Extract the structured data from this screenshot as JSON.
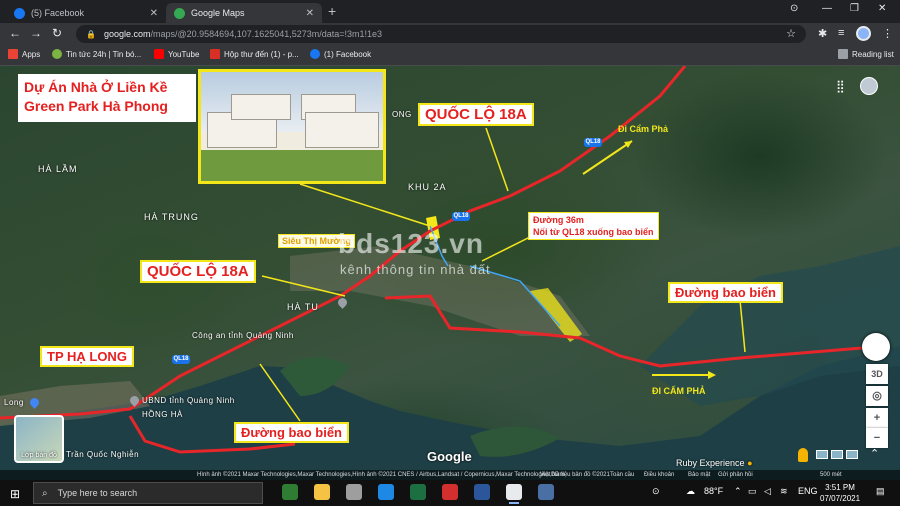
{
  "browser": {
    "tabs": [
      {
        "label": "(5) Facebook",
        "active": false,
        "favicon": "facebook-icon",
        "color": "#1877f2"
      },
      {
        "label": "Google Maps",
        "active": true,
        "favicon": "maps-icon",
        "color": "#34a853"
      }
    ],
    "address": {
      "host": "google.com",
      "path": "/maps/@20.9584694,107.1625041,5273m/data=!3m1!1e3"
    },
    "bookmarks": [
      {
        "label": "Apps",
        "icon": "apps-grid-icon"
      },
      {
        "label": "Tin tức 24h | Tin bó...",
        "icon": "news-icon"
      },
      {
        "label": "YouTube",
        "icon": "youtube-icon"
      },
      {
        "label": "Hộp thư đến (1) - p...",
        "icon": "gmail-icon"
      },
      {
        "label": "(1) Facebook",
        "icon": "facebook-icon"
      }
    ],
    "reading_list": "Reading list"
  },
  "map": {
    "project_title": [
      "Dự Án Nhà Ở Liền Kề",
      "Green Park Hà Phong"
    ],
    "callouts": {
      "ql18a_top": "QUỐC LỘ 18A",
      "ql18a_left": "QUỐC LỘ 18A",
      "tp_ha_long": "TP HẠ LONG",
      "duong_bao_bien_bottom": "Đường bao biển",
      "duong_bao_bien_right": "Đường bao biển",
      "duong_36m": [
        "Đường 36m",
        "Nối từ QL18 xuống bao biển"
      ],
      "sieu_thi": "Siêu Thị Mường"
    },
    "directions": {
      "di_cam_pha_top": "Đi Cẩm Phả",
      "di_cam_pha_bottom": "ĐI CẨM PHẢ"
    },
    "places": {
      "ha_lam": "HÀ LẦM",
      "ha_trung": "HÀ TRUNG",
      "khu_2a": "KHU 2A",
      "ha_tu": "HÀ TU",
      "cong_an": "Công an tỉnh Quảng Ninh",
      "ubnd": "UBND tỉnh Quảng Ninh",
      "hong_ha": "HỒNG HÀ",
      "long": "Long",
      "tran_quoc_nghien": "Trần Quốc Nghiễn",
      "ong": "ONG"
    },
    "shields": [
      "QL18",
      "QL18",
      "QL18"
    ],
    "watermark": "bds123.vn",
    "watermark_sub": "kênh thông tin nhà đất",
    "google_logo": "Google",
    "layer_button": "Lớp bản đồ",
    "ruby": "Ruby Experience",
    "controls": [
      "3D",
      "+",
      "−"
    ],
    "attribution": {
      "imagery": "Hình ảnh ©2021 Maxar Technologies,Maxar Technologies,Hình ảnh ©2021 CNES / Airbus,Landsat / Copernicus,Maxar Technologies,Dữ liệu bản đồ ©2021",
      "country": "Việt Nam",
      "terms": "Điều khoản",
      "privacy": "Bảo mật",
      "feedback": "Gửi phản hồi",
      "scale": "500 mét",
      "global": "Toàn cầu"
    },
    "colors": {
      "road": "#e8262a",
      "highlight": "#f3e71a",
      "callout_text": "#e52020"
    }
  },
  "taskbar": {
    "search_placeholder": "Type here to search",
    "weather": "88°F",
    "language": "ENG",
    "time": "3:51 PM",
    "date": "07/07/2021"
  }
}
